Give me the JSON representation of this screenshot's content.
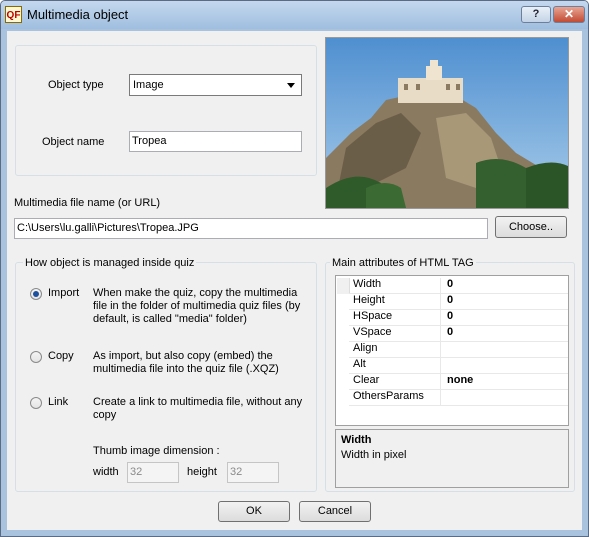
{
  "window": {
    "title": "Multimedia object",
    "help_label": "?",
    "close_label": "✕"
  },
  "object_type": {
    "label": "Object type",
    "selected": "Image"
  },
  "object_name": {
    "label": "Object name",
    "value": "Tropea"
  },
  "file": {
    "label": "Multimedia file name (or URL)",
    "path": "C:\\Users\\lu.galli\\Pictures\\Tropea.JPG",
    "choose_label": "Choose.."
  },
  "manage": {
    "title": "How object is managed inside quiz",
    "options": [
      {
        "label": "Import",
        "selected": true,
        "desc": "When make the quiz, copy the multimedia file in the folder of multimedia quiz files (by default, is called  \"media\" folder)"
      },
      {
        "label": "Copy",
        "selected": false,
        "desc": "As import, but also copy (embed) the multimedia file into the quiz file (.XQZ)"
      },
      {
        "label": "Link",
        "selected": false,
        "desc": "Create a link to multimedia file, without any copy"
      }
    ],
    "thumb": {
      "title": "Thumb image dimension :",
      "width_label": "width",
      "width_value": "32",
      "height_label": "height",
      "height_value": "32"
    }
  },
  "attributes": {
    "title": "Main attributes of HTML TAG",
    "rows": [
      {
        "name": "Width",
        "value": "0"
      },
      {
        "name": "Height",
        "value": "0"
      },
      {
        "name": "HSpace",
        "value": "0"
      },
      {
        "name": "VSpace",
        "value": "0"
      },
      {
        "name": "Align",
        "value": ""
      },
      {
        "name": "Alt",
        "value": ""
      },
      {
        "name": "Clear",
        "value": "none"
      },
      {
        "name": "OthersParams",
        "value": ""
      }
    ],
    "info_title": "Width",
    "info_desc": "Width in pixel"
  },
  "buttons": {
    "ok": "OK",
    "cancel": "Cancel"
  }
}
